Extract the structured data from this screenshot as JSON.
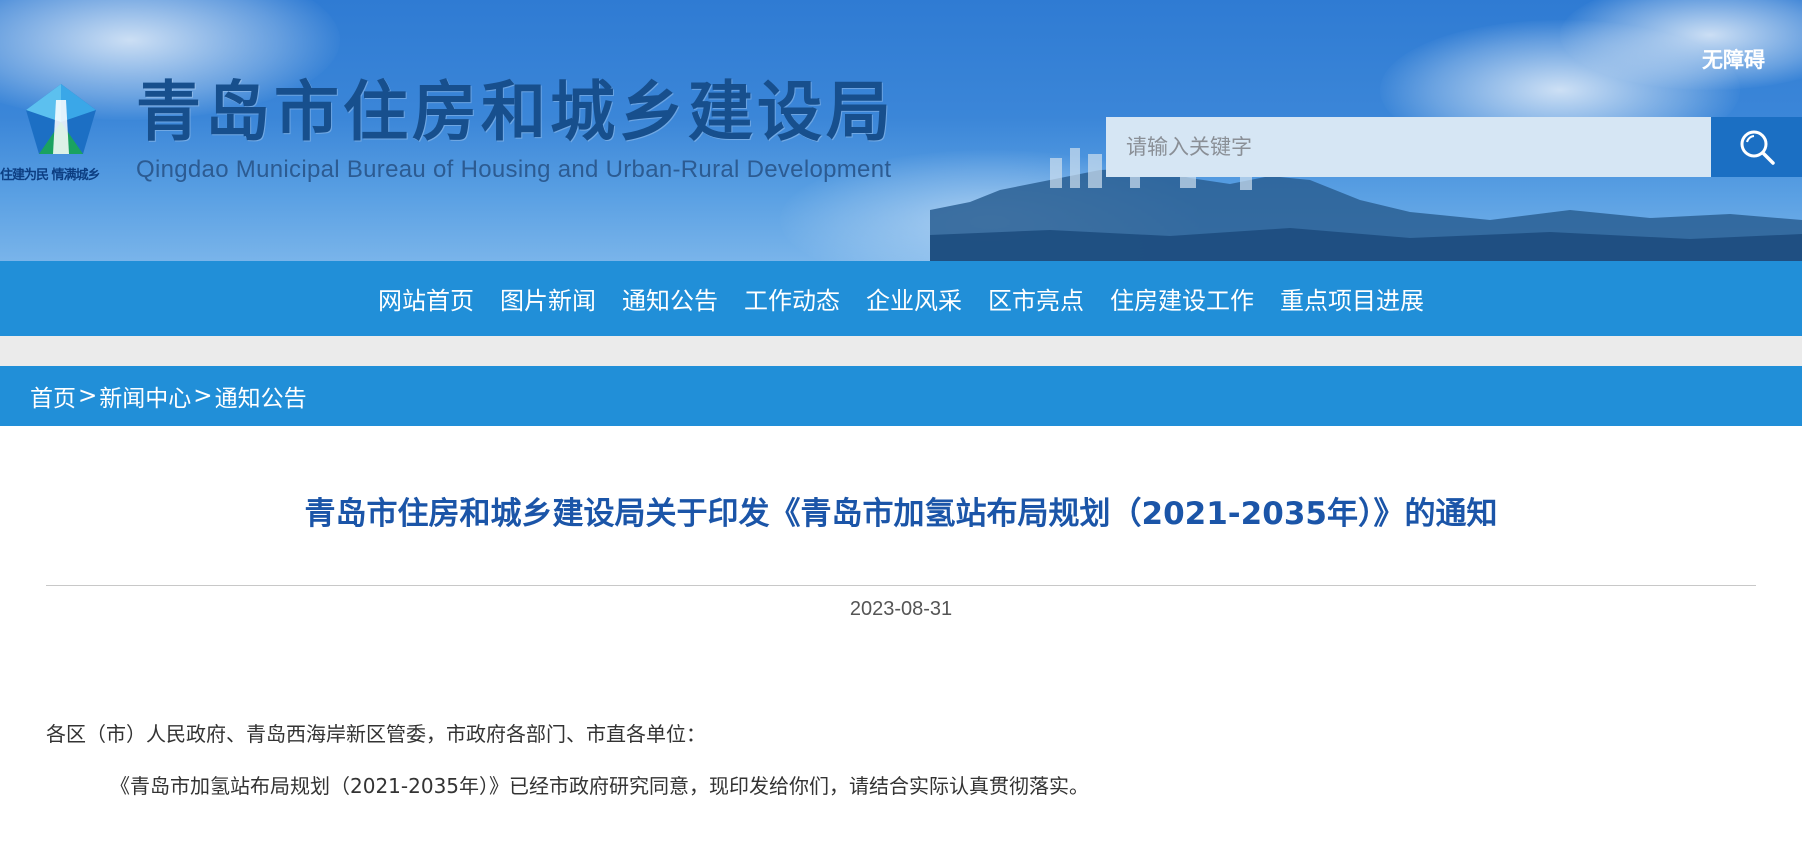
{
  "header": {
    "site_title": "青岛市住房和城乡建设局",
    "site_subtitle": "Qingdao Municipal Bureau of Housing and Urban-Rural Development",
    "slogan": "住建为民 情满城乡",
    "logo_icon": "pentagon-emblem-icon",
    "accessibility_label": "无障碍",
    "search": {
      "placeholder": "请输入关键字",
      "value": "",
      "icon": "search-icon"
    }
  },
  "nav": {
    "items": [
      {
        "label": "网站首页"
      },
      {
        "label": "图片新闻"
      },
      {
        "label": "通知公告"
      },
      {
        "label": "工作动态"
      },
      {
        "label": "企业风采"
      },
      {
        "label": "区市亮点"
      },
      {
        "label": "住房建设工作"
      },
      {
        "label": "重点项目进展"
      }
    ]
  },
  "breadcrumb": {
    "items": [
      {
        "label": "首页"
      },
      {
        "label": "新闻中心"
      },
      {
        "label": "通知公告"
      }
    ],
    "separator": ">"
  },
  "article": {
    "title": "青岛市住房和城乡建设局关于印发《青岛市加氢站布局规划（2021-2035年）》的通知",
    "date": "2023-08-31",
    "paragraphs": [
      "各区（市）人民政府、青岛西海岸新区管委，市政府各部门、市直各单位：",
      "《青岛市加氢站布局规划（2021-2035年）》已经市政府研究同意，现印发给你们，请结合实际认真贯彻落实。"
    ]
  },
  "colors": {
    "nav_bg": "#218fd8",
    "title_blue": "#1b55a8",
    "search_btn_bg": "#1b6fc3",
    "search_field_bg": "#d6e6f4"
  }
}
